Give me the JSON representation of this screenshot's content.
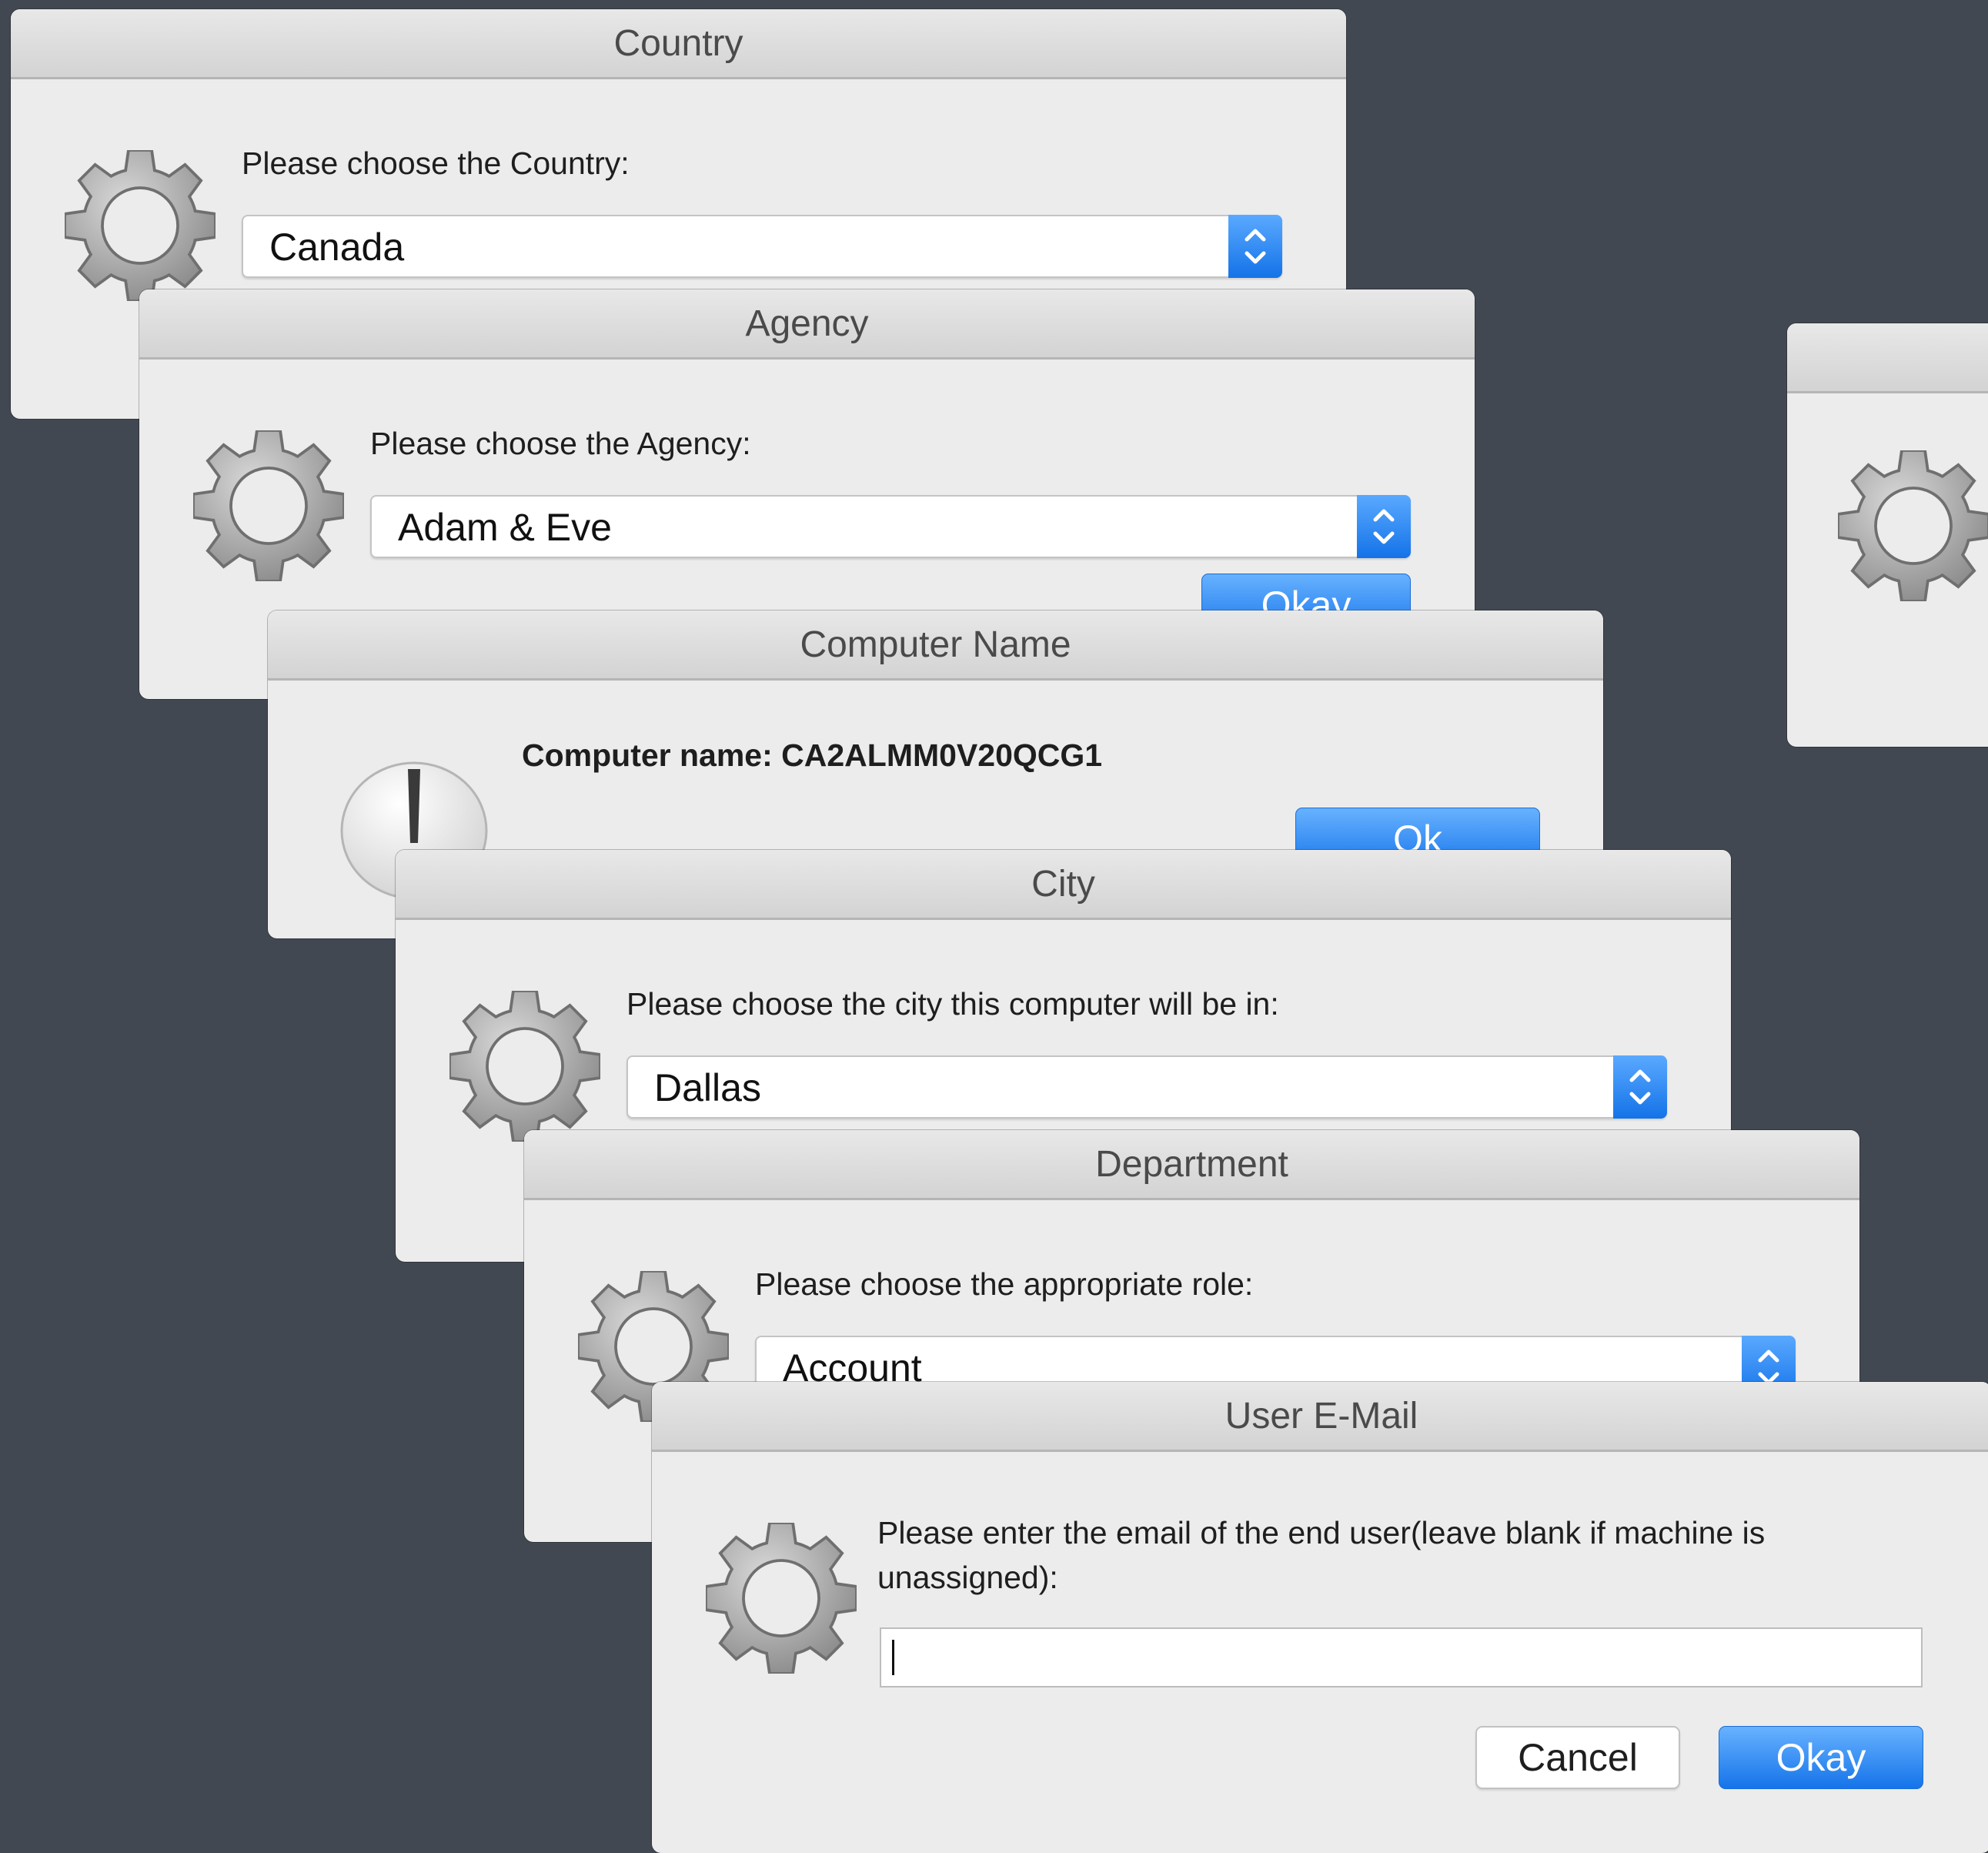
{
  "dialogs": {
    "country": {
      "title": "Country",
      "prompt": "Please choose the Country:",
      "selected": "Canada"
    },
    "agency": {
      "title": "Agency",
      "prompt": "Please choose the Agency:",
      "selected": "Adam & Eve",
      "ok_label": "Okay"
    },
    "computer_name": {
      "title": "Computer Name",
      "message": "Computer name: CA2ALMM0V20QCG1",
      "ok_label": "Ok"
    },
    "city": {
      "title": "City",
      "prompt": "Please choose the city this computer will be in:",
      "selected": "Dallas"
    },
    "department": {
      "title": "Department",
      "prompt": "Please choose the appropriate role:",
      "selected": "Account"
    },
    "user_email": {
      "title": "User E-Mail",
      "prompt_line1": "Please enter the email of the end user(leave blank if machine is",
      "prompt_line2": "unassigned):",
      "input_value": "",
      "cancel_label": "Cancel",
      "ok_label": "Okay"
    }
  },
  "icons": {
    "settings": "gear-icon",
    "alert": "exclamation-icon",
    "popup_arrows": "chevron-updown-icon"
  },
  "colors": {
    "desktop": "#424852",
    "dialog": "#ececec",
    "accent": "#1b7cf0"
  }
}
